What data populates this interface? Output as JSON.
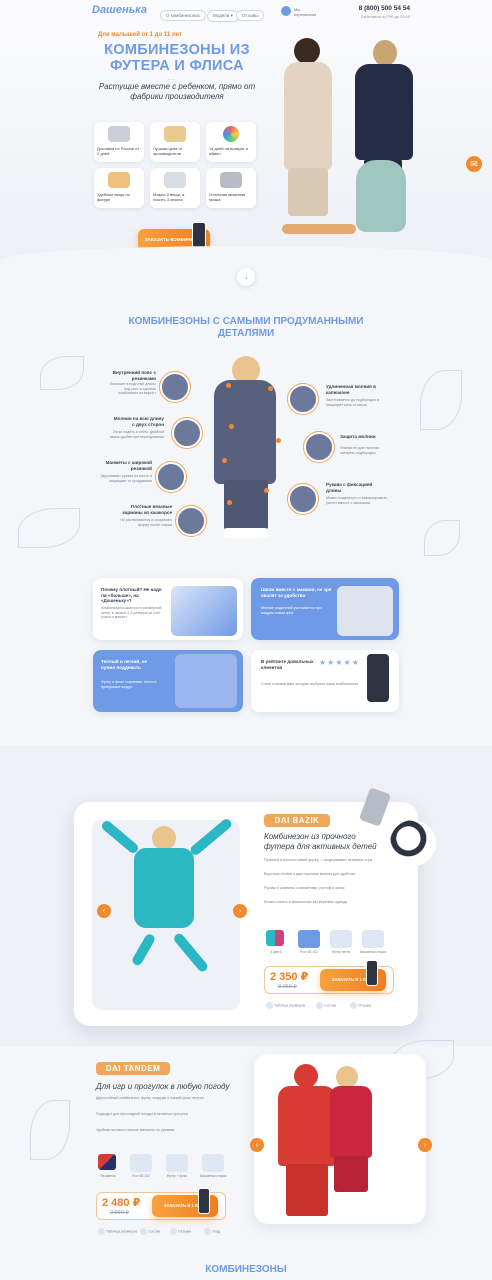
{
  "header": {
    "logo": "Dашенька",
    "nav": [
      "О комбинезонах",
      "Модели ▾",
      "Отзывы"
    ],
    "callback": "Мы\nперезвоним",
    "phone": "8 (800) 500 54 54",
    "phone_sub": "Бесплатно по РФ до 20:00"
  },
  "hero": {
    "kicker": "Для малышей от 1 до 11 лет",
    "title": "КОМБИНЕЗОНЫ ИЗ ФУТЕРА И ФЛИСА",
    "mini": "- - -",
    "subtitle": "Растущие вместе с ребенком, прямо от фабрики производителя",
    "features": [
      "Доставка по России от 2 дней",
      "Лучшая цена от производителя",
      "14 дней на возврат и обмен",
      "Удобные вещи по фигуре",
      "Можно 2 вещи, а носить 3 сезона",
      "Отличная вязанная пряжа"
    ],
    "cta": "ЗАКАЗАТЬ КОМБИНЕЗОН",
    "scroll_hint": "↓"
  },
  "details": {
    "title": "КОМБИНЕЗОНЫ С САМЫМИ ПРОДУМАННЫМИ ДЕТАЛЯМИ",
    "left": [
      {
        "title": "Внутренний пояс с резинками",
        "text": "Помогает в подгонке длины под рост и сделать комбинезон на вырост"
      },
      {
        "title": "Молнии на всю длину с двух сторон",
        "text": "Легко надеть и снять: двойной замок удобен при переодевании"
      },
      {
        "title": "Манжеты с широкой резинкой",
        "text": "Удерживают рукава на месте и защищают от продувания"
      },
      {
        "title": "Плотные вязаные карманы из кашкорсе",
        "text": "Не растягиваются и сохраняют форму после стирки"
      }
    ],
    "right": [
      {
        "title": "Удлиненная молния в капюшоне",
        "text": "Застегивается до подбородка и защищает шею от ветра"
      },
      {
        "title": "Защита молнии",
        "text": "Планка не дает молнии натирать подбородок"
      },
      {
        "title": "Рукава с фиксацией длины",
        "text": "Можно подвернуть и зафиксировать, растет вместе с малышом"
      }
    ]
  },
  "benefits": [
    {
      "title": "Почему плотный? Не надо ли «больше», на «Дашеньку»?",
      "text": "Комбинезоны шьются по размерной сетке, в запасе 2-3 размера за счет пояса и манжет"
    },
    {
      "title": "Шили вместе с мамами, не зря хвалят за удобство",
      "text": "Мнение родителей учитывается при каждом новом крое"
    },
    {
      "title": "Теплый и легкий, не нужно поддевать",
      "text": "Футер и флис сохраняют тепло и пропускают воздух"
    },
    {
      "title": "В рейтинге довольных клиентов",
      "text": "Сотни отзывов мам, которые выбрали наши комбинезоны"
    }
  ],
  "product1": {
    "tag": "DAI BAZIK",
    "title": "Комбинезон из прочного футера для активных детей",
    "bullets": [
      "Прочный и износостойкий футер — выдерживает активные игры",
      "Воротник-стойка и двусторонняя молния для удобства",
      "Рукава и штанины с манжетами, ростом в запас",
      "Можно носить в межсезонье как верхнюю одежду"
    ],
    "icons": [
      "4 цвета",
      "Рост 80-152",
      "Футер петля",
      "Машинная стирка"
    ],
    "price": "2 350 ₽",
    "old_price": "3 250 ₽",
    "cta": "ЗАКАЗАТЬ В 1 КЛИК",
    "footer": [
      "Таблица размеров",
      "Состав",
      "Отзывы"
    ]
  },
  "product2": {
    "tag": "DAI TANDEM",
    "title": "Для игр и прогулок в любую погоду",
    "bullets": [
      "Двухслойный комбинезон: футер снаружи и мягкий флис внутри",
      "Подходит для прохладной погоды и активных прогулок",
      "Удобная молния и мягкие манжеты по рукавам"
    ],
    "icons": [
      "Расцветки",
      "Рост 80-152",
      "Футер + флис",
      "Машинная стирка"
    ],
    "price": "2 480 ₽",
    "old_price": "2 990 ₽",
    "cta": "ЗАКАЗАТЬ В 1 КЛИК",
    "footer": [
      "Таблица размеров",
      "Состав",
      "Отзывы",
      "Уход"
    ]
  },
  "bottom": "КОМБИНЕЗОНЫ"
}
